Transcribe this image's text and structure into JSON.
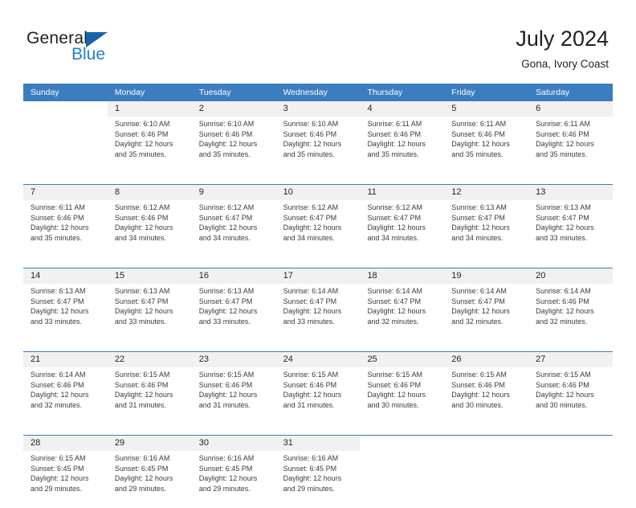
{
  "brand": {
    "word_one": "General",
    "word_two": "Blue",
    "triangle_icon": "brand-triangle-icon",
    "accent_dark": "#1565a8",
    "accent_light": "#2180c8"
  },
  "header": {
    "title": "July 2024",
    "subtitle": "Gona, Ivory Coast"
  },
  "theme": {
    "header_row_bg": "#3b7dbf",
    "day_number_bg": "#f1f1f1",
    "text": "#231f20",
    "body_text": "#3b3b3b"
  },
  "weekdays": [
    "Sunday",
    "Monday",
    "Tuesday",
    "Wednesday",
    "Thursday",
    "Friday",
    "Saturday"
  ],
  "weeks": [
    [
      {
        "day": "",
        "lines": [
          "",
          "",
          "",
          ""
        ]
      },
      {
        "day": "1",
        "lines": [
          "Sunrise: 6:10 AM",
          "Sunset: 6:46 PM",
          "Daylight: 12 hours",
          "and 35 minutes."
        ]
      },
      {
        "day": "2",
        "lines": [
          "Sunrise: 6:10 AM",
          "Sunset: 6:46 PM",
          "Daylight: 12 hours",
          "and 35 minutes."
        ]
      },
      {
        "day": "3",
        "lines": [
          "Sunrise: 6:10 AM",
          "Sunset: 6:46 PM",
          "Daylight: 12 hours",
          "and 35 minutes."
        ]
      },
      {
        "day": "4",
        "lines": [
          "Sunrise: 6:11 AM",
          "Sunset: 6:46 PM",
          "Daylight: 12 hours",
          "and 35 minutes."
        ]
      },
      {
        "day": "5",
        "lines": [
          "Sunrise: 6:11 AM",
          "Sunset: 6:46 PM",
          "Daylight: 12 hours",
          "and 35 minutes."
        ]
      },
      {
        "day": "6",
        "lines": [
          "Sunrise: 6:11 AM",
          "Sunset: 6:46 PM",
          "Daylight: 12 hours",
          "and 35 minutes."
        ]
      }
    ],
    [
      {
        "day": "7",
        "lines": [
          "Sunrise: 6:11 AM",
          "Sunset: 6:46 PM",
          "Daylight: 12 hours",
          "and 35 minutes."
        ]
      },
      {
        "day": "8",
        "lines": [
          "Sunrise: 6:12 AM",
          "Sunset: 6:46 PM",
          "Daylight: 12 hours",
          "and 34 minutes."
        ]
      },
      {
        "day": "9",
        "lines": [
          "Sunrise: 6:12 AM",
          "Sunset: 6:47 PM",
          "Daylight: 12 hours",
          "and 34 minutes."
        ]
      },
      {
        "day": "10",
        "lines": [
          "Sunrise: 6:12 AM",
          "Sunset: 6:47 PM",
          "Daylight: 12 hours",
          "and 34 minutes."
        ]
      },
      {
        "day": "11",
        "lines": [
          "Sunrise: 6:12 AM",
          "Sunset: 6:47 PM",
          "Daylight: 12 hours",
          "and 34 minutes."
        ]
      },
      {
        "day": "12",
        "lines": [
          "Sunrise: 6:13 AM",
          "Sunset: 6:47 PM",
          "Daylight: 12 hours",
          "and 34 minutes."
        ]
      },
      {
        "day": "13",
        "lines": [
          "Sunrise: 6:13 AM",
          "Sunset: 6:47 PM",
          "Daylight: 12 hours",
          "and 33 minutes."
        ]
      }
    ],
    [
      {
        "day": "14",
        "lines": [
          "Sunrise: 6:13 AM",
          "Sunset: 6:47 PM",
          "Daylight: 12 hours",
          "and 33 minutes."
        ]
      },
      {
        "day": "15",
        "lines": [
          "Sunrise: 6:13 AM",
          "Sunset: 6:47 PM",
          "Daylight: 12 hours",
          "and 33 minutes."
        ]
      },
      {
        "day": "16",
        "lines": [
          "Sunrise: 6:13 AM",
          "Sunset: 6:47 PM",
          "Daylight: 12 hours",
          "and 33 minutes."
        ]
      },
      {
        "day": "17",
        "lines": [
          "Sunrise: 6:14 AM",
          "Sunset: 6:47 PM",
          "Daylight: 12 hours",
          "and 33 minutes."
        ]
      },
      {
        "day": "18",
        "lines": [
          "Sunrise: 6:14 AM",
          "Sunset: 6:47 PM",
          "Daylight: 12 hours",
          "and 32 minutes."
        ]
      },
      {
        "day": "19",
        "lines": [
          "Sunrise: 6:14 AM",
          "Sunset: 6:47 PM",
          "Daylight: 12 hours",
          "and 32 minutes."
        ]
      },
      {
        "day": "20",
        "lines": [
          "Sunrise: 6:14 AM",
          "Sunset: 6:46 PM",
          "Daylight: 12 hours",
          "and 32 minutes."
        ]
      }
    ],
    [
      {
        "day": "21",
        "lines": [
          "Sunrise: 6:14 AM",
          "Sunset: 6:46 PM",
          "Daylight: 12 hours",
          "and 32 minutes."
        ]
      },
      {
        "day": "22",
        "lines": [
          "Sunrise: 6:15 AM",
          "Sunset: 6:46 PM",
          "Daylight: 12 hours",
          "and 31 minutes."
        ]
      },
      {
        "day": "23",
        "lines": [
          "Sunrise: 6:15 AM",
          "Sunset: 6:46 PM",
          "Daylight: 12 hours",
          "and 31 minutes."
        ]
      },
      {
        "day": "24",
        "lines": [
          "Sunrise: 6:15 AM",
          "Sunset: 6:46 PM",
          "Daylight: 12 hours",
          "and 31 minutes."
        ]
      },
      {
        "day": "25",
        "lines": [
          "Sunrise: 6:15 AM",
          "Sunset: 6:46 PM",
          "Daylight: 12 hours",
          "and 30 minutes."
        ]
      },
      {
        "day": "26",
        "lines": [
          "Sunrise: 6:15 AM",
          "Sunset: 6:46 PM",
          "Daylight: 12 hours",
          "and 30 minutes."
        ]
      },
      {
        "day": "27",
        "lines": [
          "Sunrise: 6:15 AM",
          "Sunset: 6:46 PM",
          "Daylight: 12 hours",
          "and 30 minutes."
        ]
      }
    ],
    [
      {
        "day": "28",
        "lines": [
          "Sunrise: 6:15 AM",
          "Sunset: 6:45 PM",
          "Daylight: 12 hours",
          "and 29 minutes."
        ]
      },
      {
        "day": "29",
        "lines": [
          "Sunrise: 6:16 AM",
          "Sunset: 6:45 PM",
          "Daylight: 12 hours",
          "and 29 minutes."
        ]
      },
      {
        "day": "30",
        "lines": [
          "Sunrise: 6:16 AM",
          "Sunset: 6:45 PM",
          "Daylight: 12 hours",
          "and 29 minutes."
        ]
      },
      {
        "day": "31",
        "lines": [
          "Sunrise: 6:16 AM",
          "Sunset: 6:45 PM",
          "Daylight: 12 hours",
          "and 29 minutes."
        ]
      },
      {
        "day": "",
        "lines": [
          "",
          "",
          "",
          ""
        ]
      },
      {
        "day": "",
        "lines": [
          "",
          "",
          "",
          ""
        ]
      },
      {
        "day": "",
        "lines": [
          "",
          "",
          "",
          ""
        ]
      }
    ]
  ]
}
